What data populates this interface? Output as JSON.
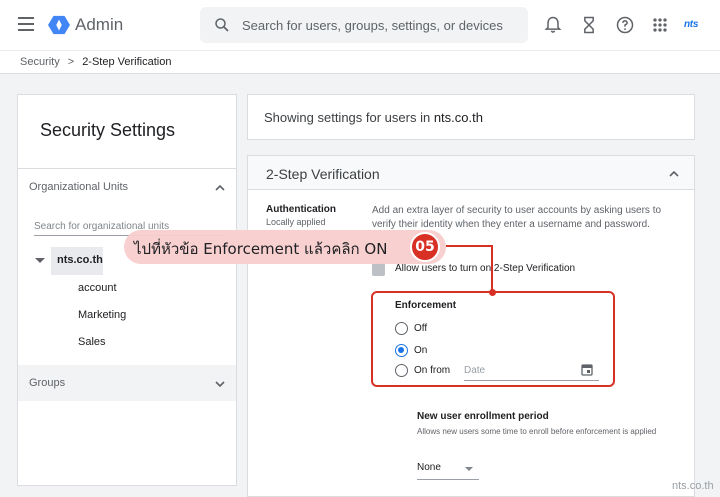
{
  "header": {
    "app_title": "Admin",
    "search_placeholder": "Search for users, groups, settings, or devices",
    "brand": "nts",
    "icons": [
      "menu-icon",
      "bell-icon",
      "hourglass-icon",
      "help-icon",
      "apps-grid-icon"
    ]
  },
  "breadcrumb": {
    "parent": "Security",
    "separator": ">",
    "current": "2-Step Verification"
  },
  "left_panel": {
    "title": "Security Settings",
    "org_units_label": "Organizational Units",
    "org_search_placeholder": "Search for organizational units",
    "tree": {
      "root": "nts.co.th",
      "children": [
        "account",
        "Marketing",
        "Sales"
      ]
    },
    "groups_label": "Groups"
  },
  "info": {
    "prefix": "Showing settings for users in ",
    "domain": "nts.co.th"
  },
  "card": {
    "title": "2-Step Verification",
    "auth_label": "Authentication",
    "auth_sub": "Locally applied",
    "description": "Add an extra layer of security to user accounts by asking users to verify their identity when they enter a username and password.",
    "allow_label": "Allow users to turn on 2-Step Verification",
    "enforcement": {
      "title": "Enforcement",
      "options": [
        "Off",
        "On",
        "On from"
      ],
      "selected": "On",
      "date_placeholder": "Date"
    },
    "enrollment": {
      "title": "New user enrollment period",
      "description": "Allows new users some time to enroll before enforcement is applied",
      "value": "None"
    }
  },
  "annotation": {
    "text": "ไปที่หัวข้อ Enforcement แล้วคลิก ON",
    "step": "05",
    "accent": "#d93025"
  },
  "watermark": "nts.co.th"
}
